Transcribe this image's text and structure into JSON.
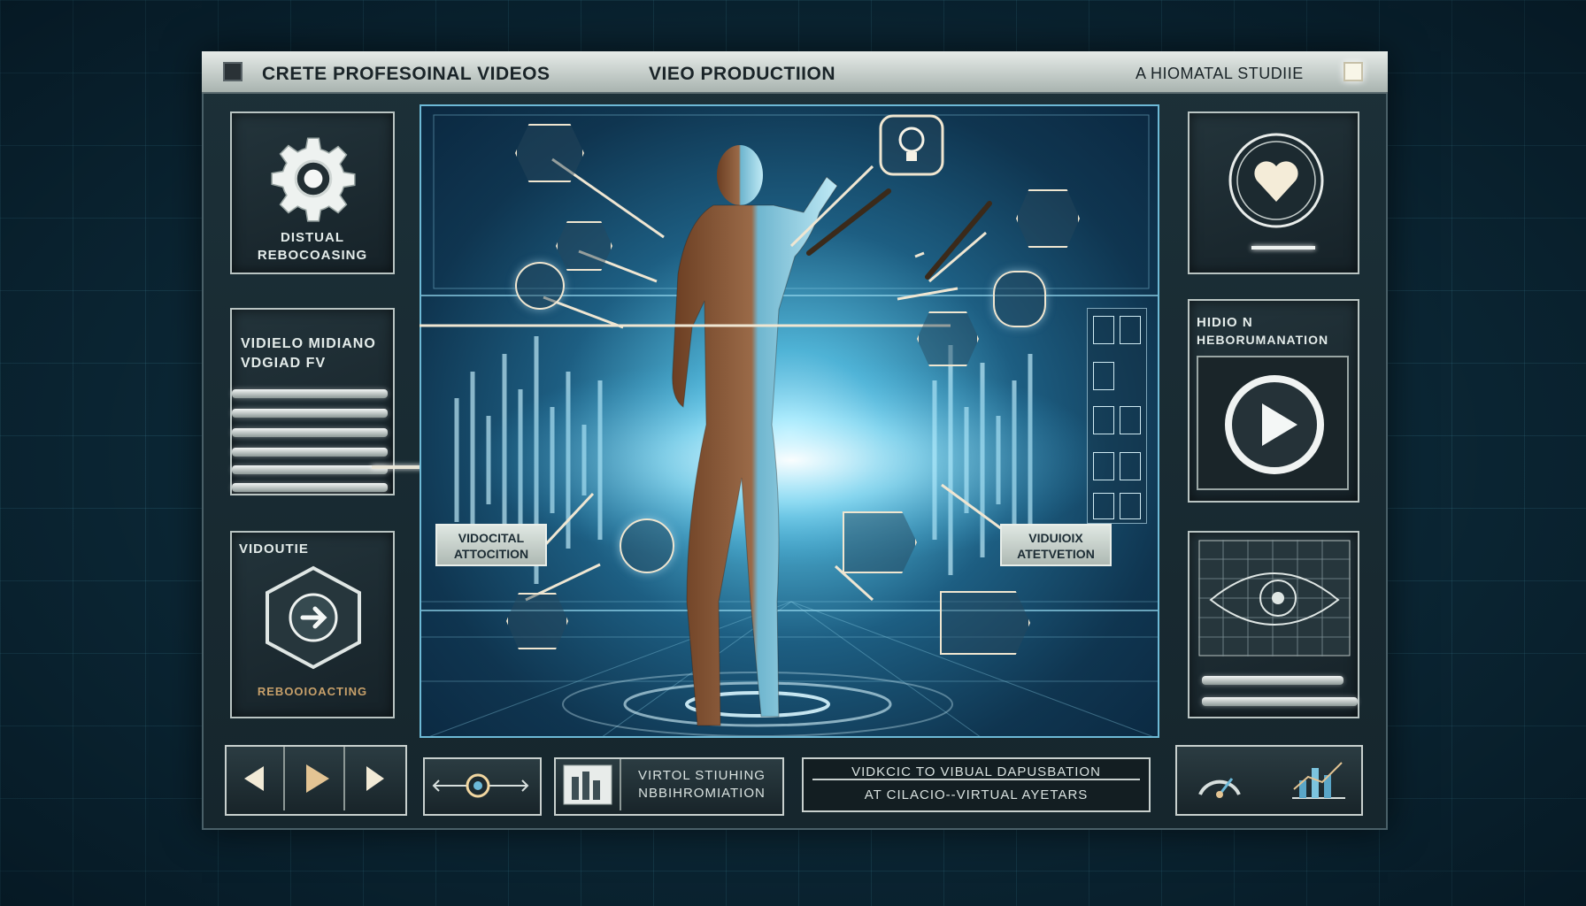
{
  "titlebar": {
    "left_title": "CRETE PROFESOINAL VIDEOS",
    "center_title": "VIEO PRODUCTIION",
    "right_title": "A HIOMATAL STUDIIE"
  },
  "left_panels": {
    "settings": {
      "label_line1": "DISTUAL",
      "label_line2": "REBOCOASING"
    },
    "media": {
      "label_line1": "VIDIELO MIDIANO",
      "label_line2": "VDGIAD FV"
    },
    "next": {
      "top_label": "VIDOUTIE",
      "bottom_label": "REBOOIOACTING"
    }
  },
  "right_panels": {
    "top": {
      "icon": "heart-icon"
    },
    "middle": {
      "label_line1": "HIDIO N",
      "label_line2": "HEBORUMANATION"
    },
    "bottom": {
      "icon": "eye-icon"
    }
  },
  "stage": {
    "callout_left_line1": "VIDOCITAL",
    "callout_left_line2": "ATTOCITION",
    "callout_right_line1": "VIDUIOIX",
    "callout_right_line2": "ATETVETION"
  },
  "footer": {
    "studio_line1": "VIRTOL STIUHING",
    "studio_line2": "NBBIHROMIATION",
    "caption_line1": "VIDKCIC TO VIBUAL DAPUSBATION",
    "caption_line2": "AT CILACIO--VIRTUAL AYETARS"
  },
  "colors": {
    "accent": "#6db9d6",
    "glow": "#bff2ff",
    "panel_border": "#b9c4c2"
  }
}
